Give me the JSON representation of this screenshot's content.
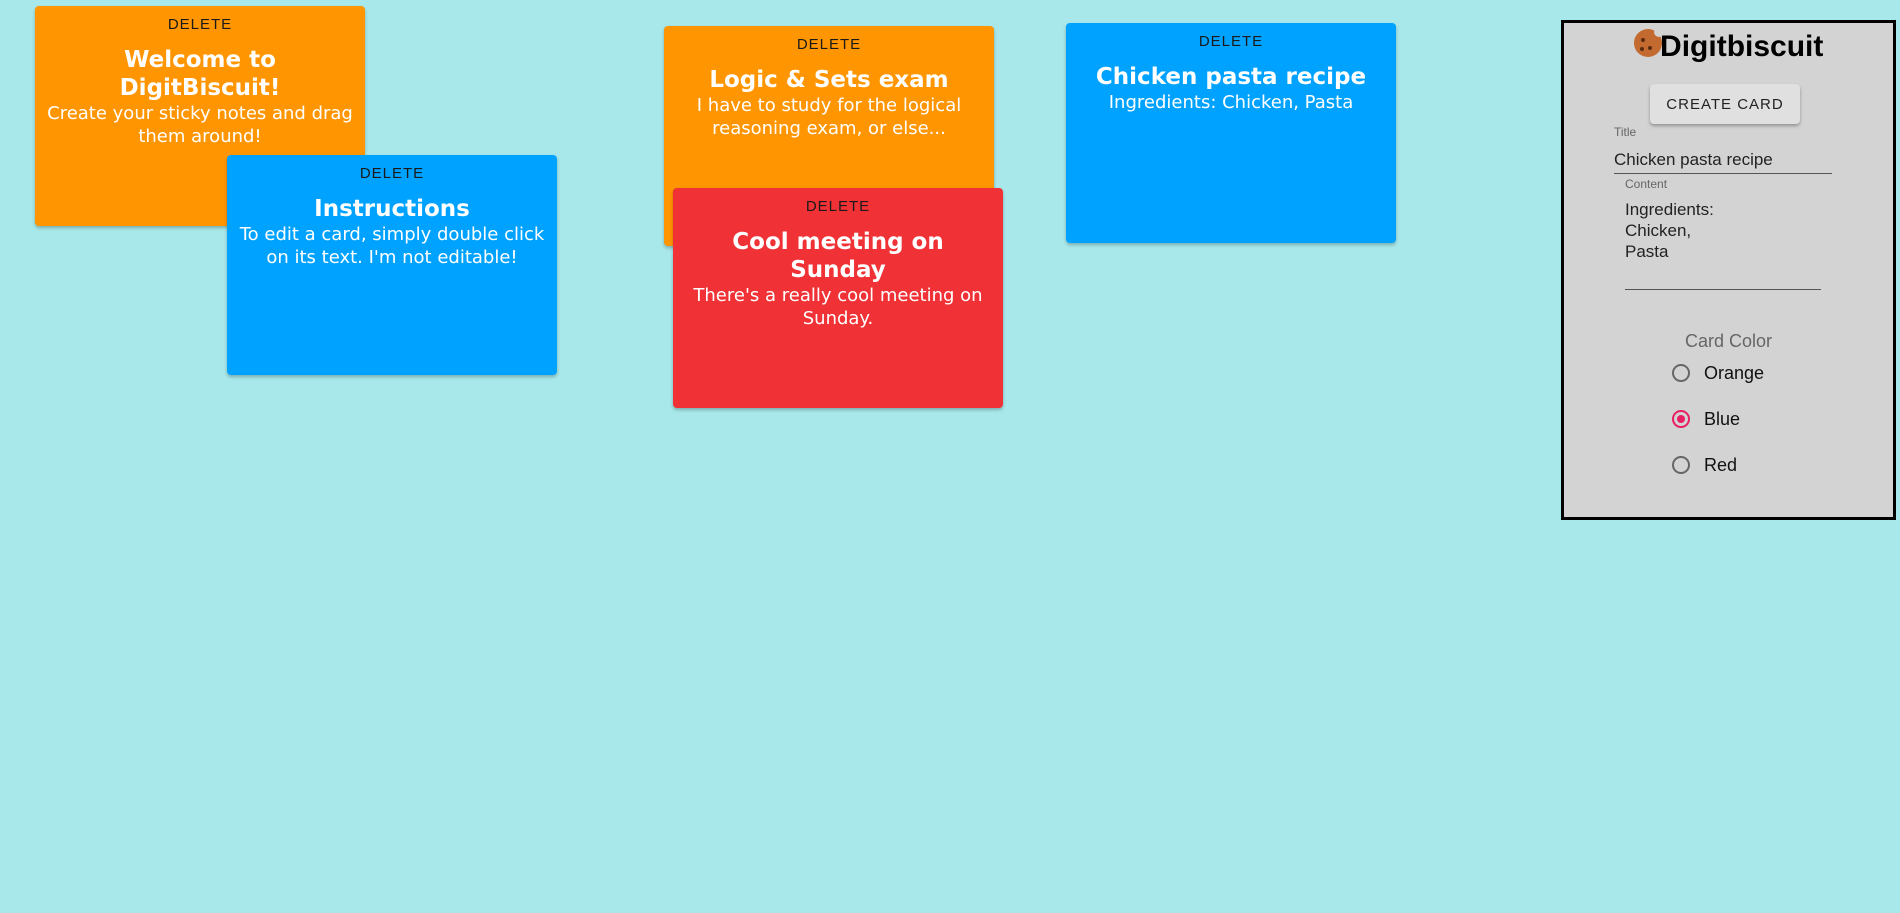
{
  "cards": [
    {
      "delete_label": "DELETE",
      "title": "Welcome to DigitBiscuit!",
      "content": "Create your sticky notes and drag them around!",
      "color": "orange"
    },
    {
      "delete_label": "DELETE",
      "title": "Instructions",
      "content": "To edit a card, simply double click on its text. I'm not editable!",
      "color": "blue"
    },
    {
      "delete_label": "DELETE",
      "title": "Logic & Sets exam",
      "content": "I have to study for the logical reasoning exam, or else...",
      "color": "orange"
    },
    {
      "delete_label": "DELETE",
      "title": "Cool meeting on Sunday",
      "content": "There's a really cool meeting on Sunday.",
      "color": "red"
    },
    {
      "delete_label": "DELETE",
      "title": "Chicken pasta recipe",
      "content": "Ingredients: Chicken, Pasta",
      "color": "blue"
    }
  ],
  "panel": {
    "app_title": "Digitbiscuit",
    "logo_icon": "cookie-icon",
    "create_button_label": "CREATE CARD",
    "title_label": "Title",
    "title_value": "Chicken pasta recipe",
    "content_label": "Content",
    "content_value": "Ingredients:\nChicken,\nPasta",
    "color_label": "Card Color",
    "color_options": [
      {
        "label": "Orange",
        "selected": false
      },
      {
        "label": "Blue",
        "selected": true
      },
      {
        "label": "Red",
        "selected": false
      }
    ]
  },
  "colors": {
    "background": "#a8e8ea",
    "orange": "#ff9500",
    "blue": "#00a2ff",
    "red": "#f03135",
    "radio_accent": "#e91e63"
  }
}
